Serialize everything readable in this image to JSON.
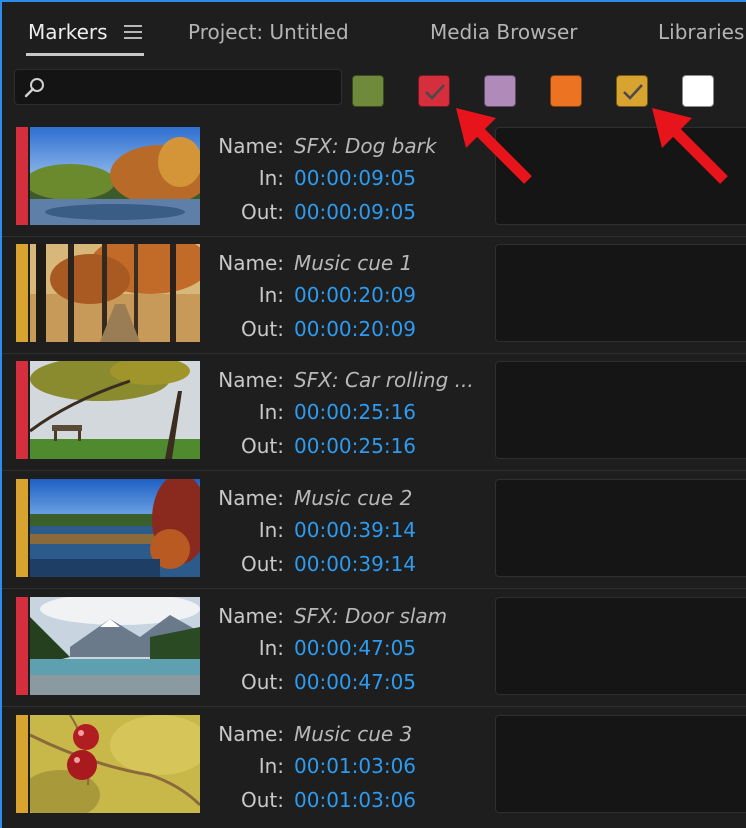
{
  "tabs": [
    {
      "label": "Markers",
      "active": true
    },
    {
      "label": "Project: Untitled",
      "active": false
    },
    {
      "label": "Media Browser",
      "active": false
    },
    {
      "label": "Libraries",
      "active": false
    }
  ],
  "search": {
    "placeholder": "",
    "value": ""
  },
  "labels": {
    "name": "Name:",
    "in": "In:",
    "out": "Out:"
  },
  "swatches": [
    {
      "name": "green",
      "color": "#6e8a3a",
      "checked": false
    },
    {
      "name": "red",
      "color": "#d52e3d",
      "checked": true
    },
    {
      "name": "violet",
      "color": "#b08bba",
      "checked": false
    },
    {
      "name": "orange",
      "color": "#eb7322",
      "checked": false
    },
    {
      "name": "yellow",
      "color": "#d8a32e",
      "checked": true
    },
    {
      "name": "white",
      "color": "#ffffff",
      "checked": false
    }
  ],
  "markers": [
    {
      "name": "SFX: Dog bark",
      "in": "00:00:09:05",
      "out": "00:00:09:05",
      "color": "#d52e3d",
      "thumb": "lake-autumn-icon"
    },
    {
      "name": "Music cue 1",
      "in": "00:00:20:09",
      "out": "00:00:20:09",
      "color": "#d8a32e",
      "thumb": "forest-trail-icon"
    },
    {
      "name": "SFX: Car rolling ...",
      "in": "00:00:25:16",
      "out": "00:00:25:16",
      "color": "#d52e3d",
      "thumb": "bench-tree-icon"
    },
    {
      "name": "Music cue 2",
      "in": "00:00:39:14",
      "out": "00:00:39:14",
      "color": "#d8a32e",
      "thumb": "marsh-lake-icon"
    },
    {
      "name": "SFX: Door slam",
      "in": "00:00:47:05",
      "out": "00:00:47:05",
      "color": "#d52e3d",
      "thumb": "mountain-river-icon"
    },
    {
      "name": "Music cue 3",
      "in": "00:01:03:06",
      "out": "00:01:03:06",
      "color": "#d8a32e",
      "thumb": "red-berries-icon"
    }
  ]
}
